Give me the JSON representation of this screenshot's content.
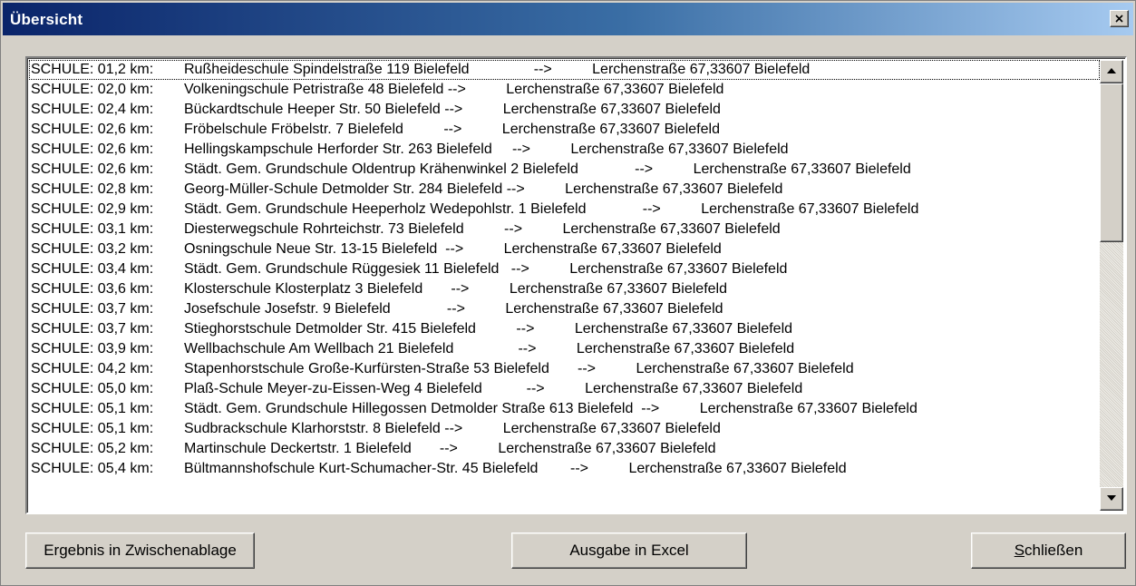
{
  "window": {
    "title": "Übersicht",
    "close_glyph": "close-icon"
  },
  "list": {
    "rows": [
      {
        "prefix": "SCHULE: 01,2 km:",
        "text": "Rußheideschule Spindelstraße 119 Bielefeld                -->          Lerchenstraße 67,33607 Bielefeld"
      },
      {
        "prefix": "SCHULE: 02,0 km:",
        "text": "Volkeningschule Petristraße 48 Bielefeld -->          Lerchenstraße 67,33607 Bielefeld"
      },
      {
        "prefix": "SCHULE: 02,4 km:",
        "text": "Bückardtschule Heeper Str. 50 Bielefeld -->          Lerchenstraße 67,33607 Bielefeld"
      },
      {
        "prefix": "SCHULE: 02,6 km:",
        "text": "Fröbelschule Fröbelstr. 7 Bielefeld          -->          Lerchenstraße 67,33607 Bielefeld"
      },
      {
        "prefix": "SCHULE: 02,6 km:",
        "text": "Hellingskampschule Herforder Str. 263 Bielefeld     -->          Lerchenstraße 67,33607 Bielefeld"
      },
      {
        "prefix": "SCHULE: 02,6 km:",
        "text": "Städt. Gem. Grundschule Oldentrup Krähenwinkel 2 Bielefeld              -->          Lerchenstraße 67,33607 Bielefeld"
      },
      {
        "prefix": "SCHULE: 02,8 km:",
        "text": "Georg-Müller-Schule Detmolder Str. 284 Bielefeld -->          Lerchenstraße 67,33607 Bielefeld"
      },
      {
        "prefix": "SCHULE: 02,9 km:",
        "text": "Städt. Gem. Grundschule Heeperholz Wedepohlstr. 1 Bielefeld              -->          Lerchenstraße 67,33607 Bielefeld"
      },
      {
        "prefix": "SCHULE: 03,1 km:",
        "text": "Diesterwegschule Rohrteichstr. 73 Bielefeld          -->          Lerchenstraße 67,33607 Bielefeld"
      },
      {
        "prefix": "SCHULE: 03,2 km:",
        "text": "Osningschule Neue Str. 13-15 Bielefeld  -->          Lerchenstraße 67,33607 Bielefeld"
      },
      {
        "prefix": "SCHULE: 03,4 km:",
        "text": "Städt. Gem. Grundschule Rüggesiek 11 Bielefeld   -->          Lerchenstraße 67,33607 Bielefeld"
      },
      {
        "prefix": "SCHULE: 03,6 km:",
        "text": "Klosterschule Klosterplatz 3 Bielefeld       -->          Lerchenstraße 67,33607 Bielefeld"
      },
      {
        "prefix": "SCHULE: 03,7 km:",
        "text": "Josefschule Josefstr. 9 Bielefeld              -->          Lerchenstraße 67,33607 Bielefeld"
      },
      {
        "prefix": "SCHULE: 03,7 km:",
        "text": "Stieghorstschule Detmolder Str. 415 Bielefeld          -->          Lerchenstraße 67,33607 Bielefeld"
      },
      {
        "prefix": "SCHULE: 03,9 km:",
        "text": "Wellbachschule Am Wellbach 21 Bielefeld                -->          Lerchenstraße 67,33607 Bielefeld"
      },
      {
        "prefix": "SCHULE: 04,2 km:",
        "text": "Stapenhorstschule Große-Kurfürsten-Straße 53 Bielefeld       -->          Lerchenstraße 67,33607 Bielefeld"
      },
      {
        "prefix": "SCHULE: 05,0 km:",
        "text": "Plaß-Schule Meyer-zu-Eissen-Weg 4 Bielefeld           -->          Lerchenstraße 67,33607 Bielefeld"
      },
      {
        "prefix": "SCHULE: 05,1 km:",
        "text": "Städt. Gem. Grundschule Hillegossen Detmolder Straße 613 Bielefeld  -->          Lerchenstraße 67,33607 Bielefeld"
      },
      {
        "prefix": "SCHULE: 05,1 km:",
        "text": "Sudbrackschule Klarhorststr. 8 Bielefeld -->          Lerchenstraße 67,33607 Bielefeld"
      },
      {
        "prefix": "SCHULE: 05,2 km:",
        "text": "Martinschule Deckertstr. 1 Bielefeld       -->          Lerchenstraße 67,33607 Bielefeld"
      },
      {
        "prefix": "SCHULE: 05,4 km:",
        "text": "Bültmannshofschule Kurt-Schumacher-Str. 45 Bielefeld        -->          Lerchenstraße 67,33607 Bielefeld"
      }
    ]
  },
  "buttons": {
    "copy_label": "Ergebnis in Zwischenablage",
    "excel_label": "Ausgabe in Excel",
    "close_accel": "S",
    "close_rest": "chließen"
  },
  "scrollbar": {
    "up_icon": "scroll-up-arrow-icon",
    "down_icon": "scroll-down-arrow-icon"
  }
}
